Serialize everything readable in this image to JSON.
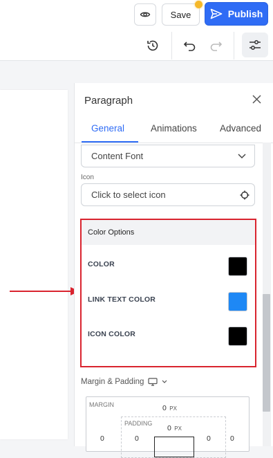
{
  "toolbar": {
    "save_label": "Save",
    "publish_label": "Publish"
  },
  "panel": {
    "title": "Paragraph",
    "tabs": [
      "General",
      "Animations",
      "Advanced"
    ],
    "active_tab": "General",
    "font_select_value": "Content Font",
    "icon_label": "Icon",
    "icon_placeholder": "Click to select icon"
  },
  "color_options": {
    "title": "Color Options",
    "items": [
      {
        "label": "COLOR",
        "color": "#000000"
      },
      {
        "label": "LINK TEXT COLOR",
        "color": "#1e88f5"
      },
      {
        "label": "ICON COLOR",
        "color": "#000000"
      }
    ]
  },
  "spacing": {
    "title": "Margin & Padding",
    "margin_label": "MARGIN",
    "margin_value": "0",
    "padding_label": "PADDING",
    "padding_value": "0",
    "unit": "PX",
    "left_margin": "0",
    "left_padding": "0",
    "right_padding": "0",
    "right_margin": "0"
  },
  "colors": {
    "accent": "#2f6cf5",
    "highlight_border": "#d9232e",
    "status_dot": "#f5b82a"
  }
}
